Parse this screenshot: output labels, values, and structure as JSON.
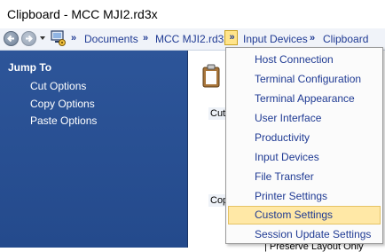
{
  "window": {
    "title": "Clipboard - MCC MJI2.rd3x"
  },
  "navbar": {
    "breadcrumbs": [
      {
        "id": "documents",
        "label": "Documents"
      },
      {
        "id": "mcc",
        "label": "MCC MJI2.rd3x"
      },
      {
        "id": "input",
        "label": "Input Devices"
      },
      {
        "id": "clipboard",
        "label": "Clipboard"
      }
    ],
    "separator": "»"
  },
  "sidebar": {
    "heading": "Jump To",
    "links": [
      {
        "label": "Cut Options"
      },
      {
        "label": "Copy Options"
      },
      {
        "label": "Paste Options"
      }
    ]
  },
  "content": {
    "label_top": "Cut",
    "label_mid": "Cop",
    "bottom_text": "| Preserve Layout Only"
  },
  "menu": {
    "items": [
      {
        "label": "Host Connection"
      },
      {
        "label": "Terminal Configuration"
      },
      {
        "label": "Terminal Appearance"
      },
      {
        "label": "User Interface"
      },
      {
        "label": "Productivity"
      },
      {
        "label": "Input Devices"
      },
      {
        "label": "File Transfer"
      },
      {
        "label": "Printer Settings"
      },
      {
        "label": "Custom Settings"
      },
      {
        "label": "Session Update Settings"
      }
    ],
    "highlighted_index": 8
  },
  "colors": {
    "sidebar": "#2d5599",
    "link": "#1f3a93",
    "highlight": "#ffe8a6"
  }
}
